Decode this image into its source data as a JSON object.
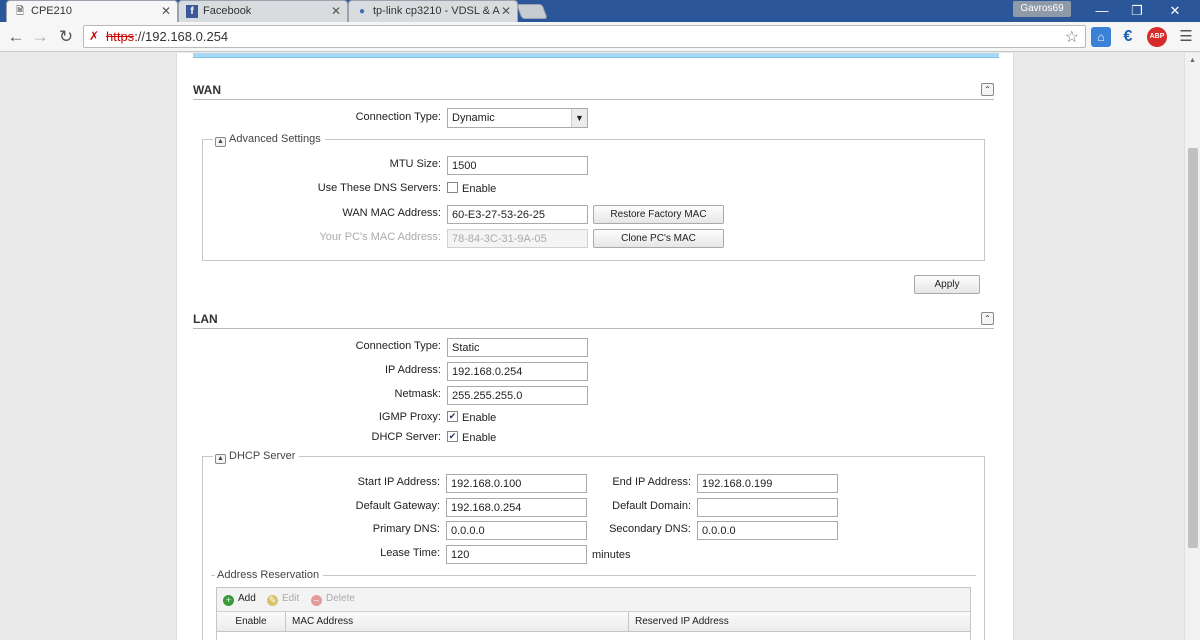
{
  "browser": {
    "tabs": [
      {
        "title": "CPE210",
        "icon": "page-icon",
        "active": true
      },
      {
        "title": "Facebook",
        "icon": "facebook-icon",
        "active": false
      },
      {
        "title": "tp-link cp3210 - VDSL & A",
        "icon": "search-icon",
        "active": false
      }
    ],
    "user": "Gavros69",
    "url_protocol": "https",
    "url_rest": "://192.168.0.254",
    "extensions": {
      "abp": "ABP",
      "euro": "€"
    }
  },
  "wan": {
    "title": "WAN",
    "connection_type_label": "Connection Type:",
    "connection_type_value": "Dynamic",
    "advanced_legend": "Advanced Settings",
    "mtu_label": "MTU Size:",
    "mtu_value": "1500",
    "dns_label": "Use These DNS Servers:",
    "dns_enable_label": "Enable",
    "dns_enabled": false,
    "wan_mac_label": "WAN MAC Address:",
    "wan_mac_value": "60-E3-27-53-26-25",
    "restore_button": "Restore Factory MAC",
    "pc_mac_label": "Your PC's MAC Address:",
    "pc_mac_value": "78-84-3C-31-9A-05",
    "clone_button": "Clone PC's MAC",
    "apply_button": "Apply"
  },
  "lan": {
    "title": "LAN",
    "connection_type_label": "Connection Type:",
    "connection_type_value": "Static",
    "ip_label": "IP Address:",
    "ip_value": "192.168.0.254",
    "netmask_label": "Netmask:",
    "netmask_value": "255.255.255.0",
    "igmp_label": "IGMP Proxy:",
    "igmp_enable_label": "Enable",
    "igmp_enabled": true,
    "dhcp_label": "DHCP Server:",
    "dhcp_enable_label": "Enable",
    "dhcp_enabled": true
  },
  "dhcp": {
    "legend": "DHCP Server",
    "start_ip_label": "Start IP Address:",
    "start_ip_value": "192.168.0.100",
    "end_ip_label": "End IP Address:",
    "end_ip_value": "192.168.0.199",
    "gateway_label": "Default Gateway:",
    "gateway_value": "192.168.0.254",
    "domain_label": "Default Domain:",
    "domain_value": "",
    "primary_dns_label": "Primary DNS:",
    "primary_dns_value": "0.0.0.0",
    "secondary_dns_label": "Secondary DNS:",
    "secondary_dns_value": "0.0.0.0",
    "lease_label": "Lease Time:",
    "lease_value": "120",
    "lease_unit": "minutes"
  },
  "reservation": {
    "legend": "Address Reservation",
    "add_label": "Add",
    "edit_label": "Edit",
    "delete_label": "Delete",
    "columns": [
      "Enable",
      "MAC Address",
      "Reserved IP Address"
    ]
  }
}
